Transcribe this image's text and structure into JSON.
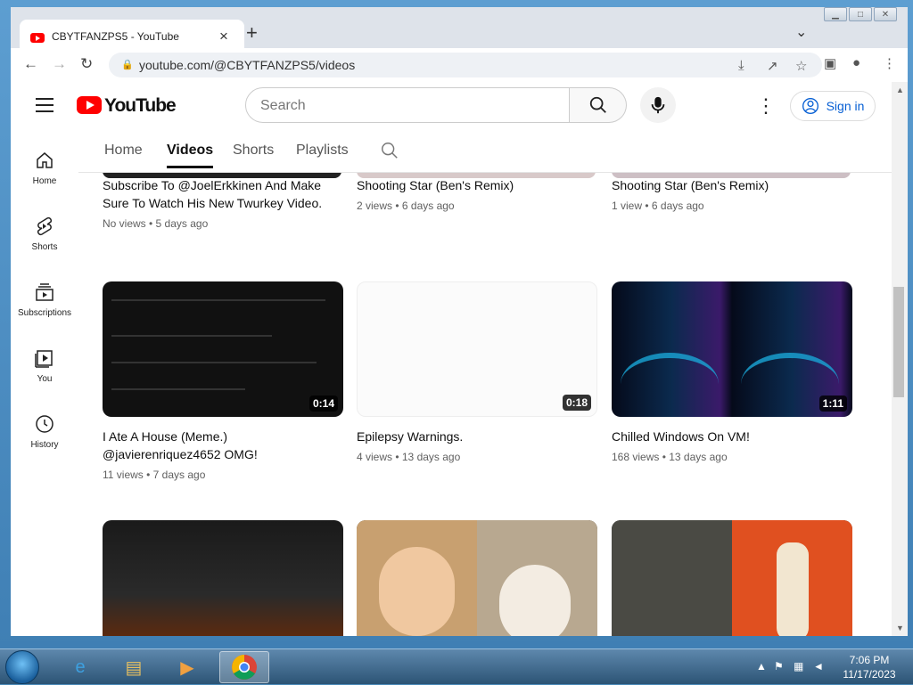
{
  "browser": {
    "tab_title": "CBYTFANZPS5 - YouTube",
    "url": "youtube.com/@CBYTFANZPS5/videos"
  },
  "youtube": {
    "logo_text": "YouTube",
    "search_placeholder": "Search",
    "sign_in": "Sign in",
    "sidebar": [
      {
        "label": "Home",
        "icon": "home-icon"
      },
      {
        "label": "Shorts",
        "icon": "shorts-icon"
      },
      {
        "label": "Subscriptions",
        "icon": "subscriptions-icon"
      },
      {
        "label": "You",
        "icon": "you-icon"
      },
      {
        "label": "History",
        "icon": "history-icon"
      }
    ],
    "channel_tabs": [
      "Home",
      "Videos",
      "Shorts",
      "Playlists"
    ],
    "active_tab": "Videos",
    "videos": [
      {
        "title": "Subscribe To @JoelErkkinen And Make Sure To Watch His New Twurkey Video.",
        "meta": "No views • 5 days ago"
      },
      {
        "title": "Shooting Star (Ben's Remix)",
        "meta": "2 views • 6 days ago"
      },
      {
        "title": "Shooting Star (Ben's Remix)",
        "meta": "1 view • 6 days ago"
      },
      {
        "title": "I Ate A House (Meme.) @javierenriquez4652 OMG!",
        "meta": "11 views • 7 days ago",
        "duration": "0:14"
      },
      {
        "title": "Epilepsy Warnings.",
        "meta": "4 views • 13 days ago",
        "duration": "0:18"
      },
      {
        "title": "Chilled Windows On VM!",
        "meta": "168 views • 13 days ago",
        "duration": "1:11"
      }
    ]
  },
  "taskbar": {
    "time": "7:06 PM",
    "date": "11/17/2023"
  }
}
